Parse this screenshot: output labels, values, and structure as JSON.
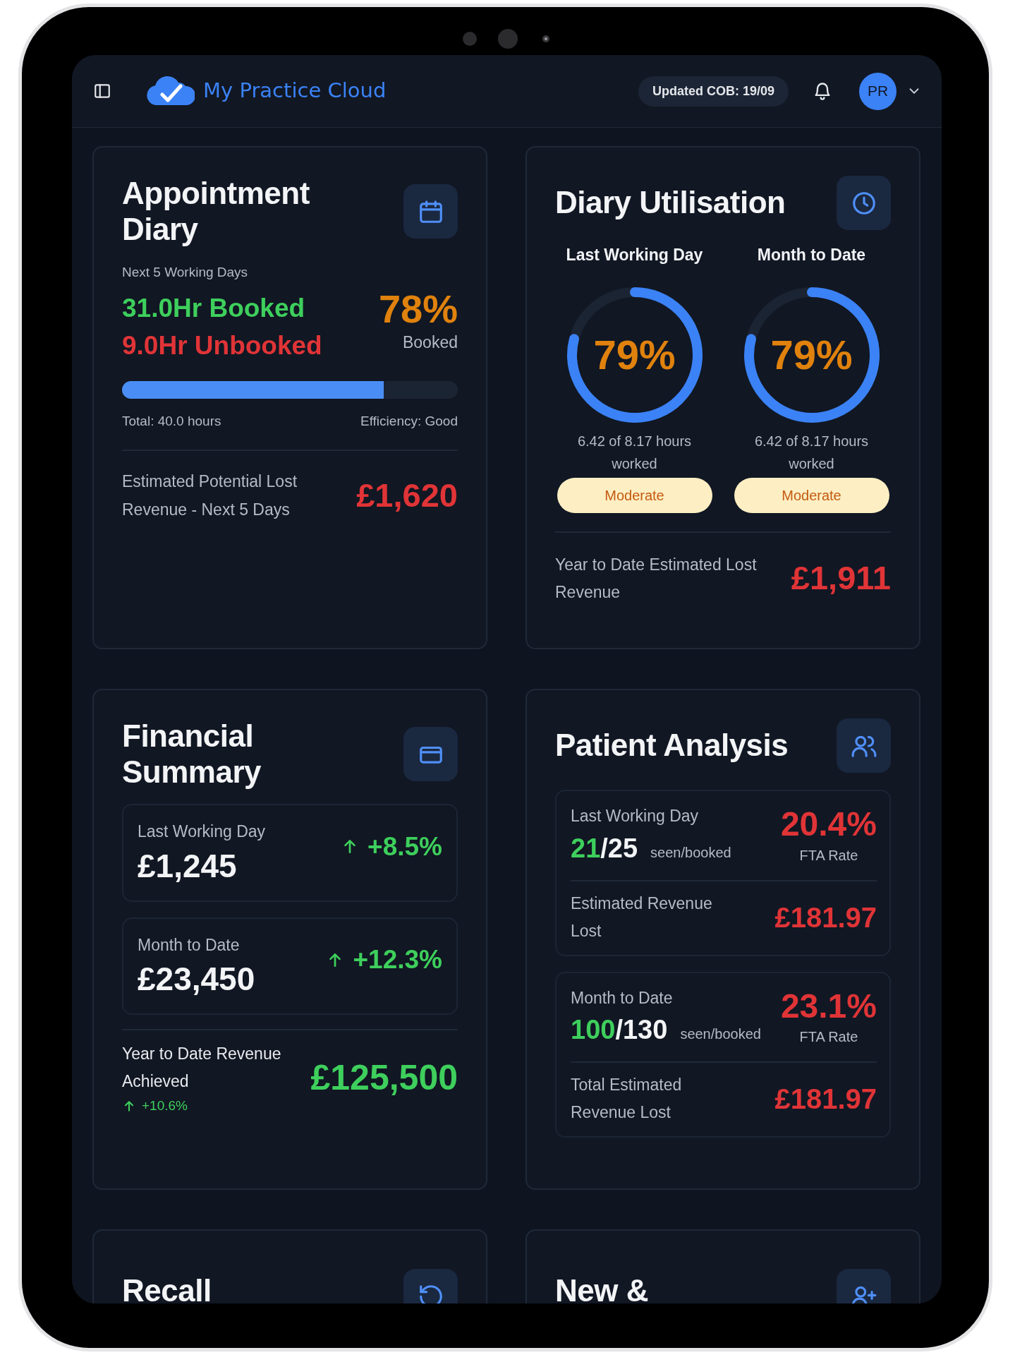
{
  "header": {
    "brand": "My Practice Cloud",
    "updated": "Updated COB: 19/09",
    "avatar": "PR"
  },
  "cards": [
    {
      "kind": "appointment",
      "title": "Appointment Diary",
      "subtitle": "Next 5 Working Days",
      "booked": "31.0Hr Booked",
      "unbooked": "9.0Hr Unbooked",
      "percent": "78%",
      "percent_label": "Booked",
      "progress": {
        "level": 0.78
      },
      "total": "Total: 40.0 hours",
      "efficiency": "Efficiency: Good",
      "lost_label": "Estimated Potential Lost Revenue - Next 5 Days",
      "lost_value": "£1,620"
    },
    {
      "kind": "utilisation",
      "title": "Diary Utilisation",
      "gauges": [
        {
          "label": "Last Working Day",
          "value": "79%",
          "level": 0.79,
          "detail": "6.42 of 8.17 hours worked",
          "status": "Moderate"
        },
        {
          "label": "Month to Date",
          "value": "79%",
          "level": 0.79,
          "detail": "6.42 of 8.17 hours worked",
          "status": "Moderate"
        }
      ],
      "footer_label": "Year to Date Estimated Lost Revenue",
      "footer_value": "£1,911"
    },
    {
      "kind": "financial",
      "title": "Financial Summary",
      "stats": [
        {
          "label": "Last Working Day",
          "value": "£1,245",
          "change": "+8.5%"
        },
        {
          "label": "Month to Date",
          "value": "£23,450",
          "change": "+12.3%"
        }
      ],
      "ytd_label": "Year to Date Revenue Achieved",
      "ytd_value": "£125,500",
      "ytd_change": "+10.6%"
    },
    {
      "kind": "patients",
      "title": "Patient Analysis",
      "blocks": [
        {
          "label": "Last Working Day",
          "seen": "21",
          "booked": "/25",
          "unit": "seen/booked",
          "rate": "20.4%",
          "rate_label": "FTA Rate",
          "lost_label": "Estimated Revenue Lost",
          "lost_value": "£181.97"
        },
        {
          "label": "Month to Date",
          "seen": "100",
          "booked": "/130",
          "unit": "seen/booked",
          "rate": "23.1%",
          "rate_label": "FTA Rate",
          "lost_label": "Total Estimated Revenue Lost",
          "lost_value": "£181.97"
        }
      ]
    },
    {
      "kind": "recall",
      "title": "Recall"
    },
    {
      "kind": "new",
      "title": "New &"
    }
  ]
}
